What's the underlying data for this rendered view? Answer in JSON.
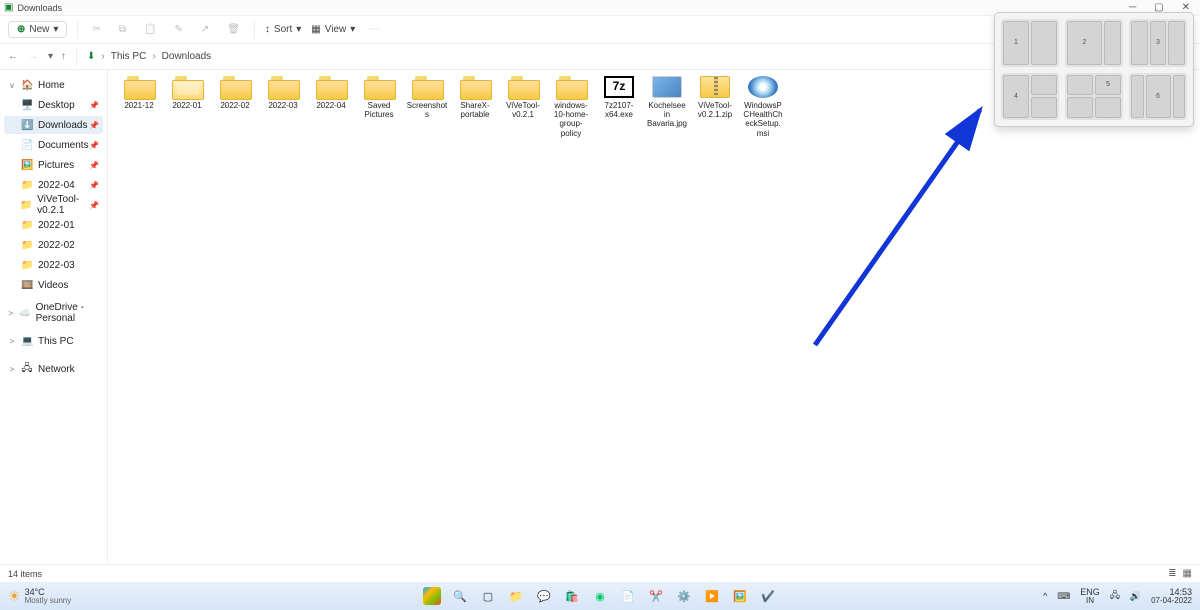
{
  "window": {
    "title": "Downloads"
  },
  "toolbar": {
    "new_label": "New",
    "sort_label": "Sort",
    "view_label": "View"
  },
  "breadcrumbs": [
    "This PC",
    "Downloads"
  ],
  "sidebar": {
    "items": [
      {
        "label": "Home",
        "icon": "🏠",
        "chev": "v",
        "pinned": false
      },
      {
        "label": "Desktop",
        "icon": "🖥️",
        "pinned": true
      },
      {
        "label": "Downloads",
        "icon": "⬇️",
        "pinned": true,
        "selected": true
      },
      {
        "label": "Documents",
        "icon": "📄",
        "pinned": true
      },
      {
        "label": "Pictures",
        "icon": "🖼️",
        "pinned": true
      },
      {
        "label": "2022-04",
        "icon": "📁",
        "pinned": true
      },
      {
        "label": "ViVeTool-v0.2.1",
        "icon": "📁",
        "pinned": true
      },
      {
        "label": "2022-01",
        "icon": "📁"
      },
      {
        "label": "2022-02",
        "icon": "📁"
      },
      {
        "label": "2022-03",
        "icon": "📁"
      },
      {
        "label": "Videos",
        "icon": "🎞️"
      },
      {
        "label": "OneDrive - Personal",
        "icon": "☁️",
        "chev": ">"
      },
      {
        "label": "This PC",
        "icon": "💻",
        "chev": ">"
      },
      {
        "label": "Network",
        "icon": "🖧",
        "chev": ">"
      }
    ]
  },
  "files": {
    "items": [
      {
        "name": "2021-12",
        "kind": "folder"
      },
      {
        "name": "2022-01",
        "kind": "folder-open"
      },
      {
        "name": "2022-02",
        "kind": "folder"
      },
      {
        "name": "2022-03",
        "kind": "folder"
      },
      {
        "name": "2022-04",
        "kind": "folder"
      },
      {
        "name": "Saved Pictures",
        "kind": "folder"
      },
      {
        "name": "Screenshots",
        "kind": "folder"
      },
      {
        "name": "ShareX-portable",
        "kind": "folder"
      },
      {
        "name": "ViVeTool-v0.2.1",
        "kind": "folder"
      },
      {
        "name": "windows-10-home-group-policy",
        "kind": "folder"
      },
      {
        "name": "7z2107-x64.exe",
        "kind": "7z"
      },
      {
        "name": "Kochelsee in Bavaria.jpg",
        "kind": "img"
      },
      {
        "name": "ViVeTool-v0.2.1.zip",
        "kind": "zip"
      },
      {
        "name": "WindowsPCHealthCheckSetup.msi",
        "kind": "msi"
      }
    ]
  },
  "status": {
    "count": "14 items"
  },
  "taskbar": {
    "temp": "34°C",
    "cond": "Mostly sunny",
    "lang1": "ENG",
    "lang2": "IN",
    "time": "14:53",
    "date": "07-04-2022"
  },
  "snap": {
    "labels": [
      "1",
      "2",
      "3",
      "4",
      "5",
      "6"
    ]
  }
}
